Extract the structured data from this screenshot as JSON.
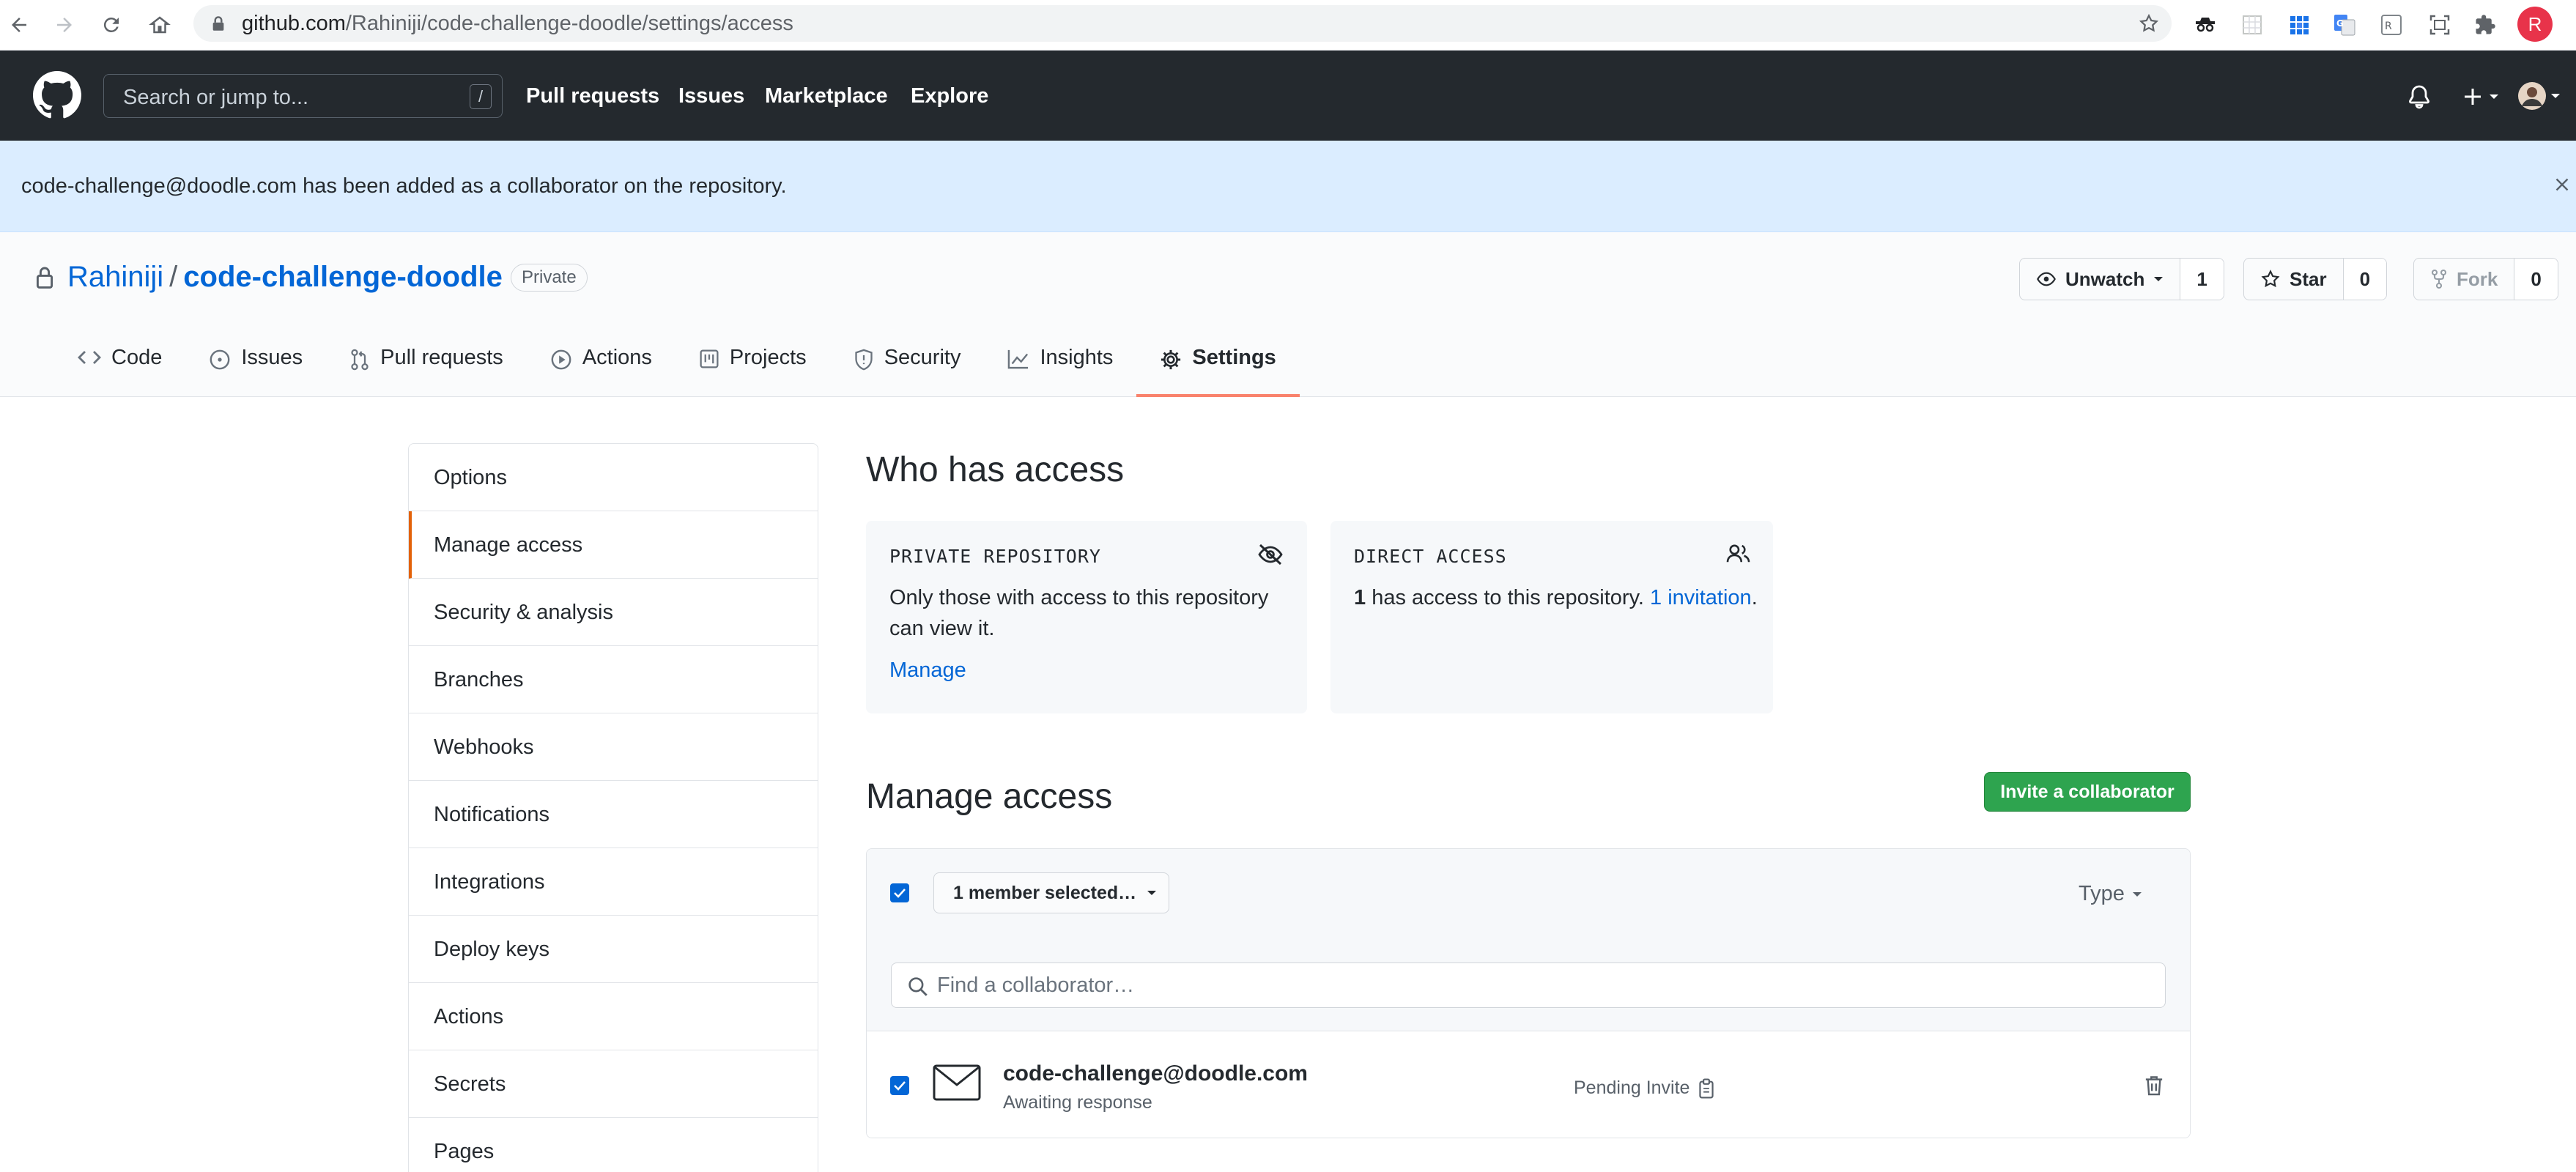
{
  "browser": {
    "url_host": "github.com",
    "url_path": "/Rahiniji/code-challenge-doodle/settings/access",
    "profile_initial": "R"
  },
  "header": {
    "search_placeholder": "Search or jump to...",
    "search_shortcut": "/",
    "nav": [
      "Pull requests",
      "Issues",
      "Marketplace",
      "Explore"
    ]
  },
  "flash": {
    "message": "code-challenge@doodle.com has been added as a collaborator on the repository."
  },
  "repo": {
    "owner": "Rahiniji",
    "separator": "/",
    "name": "code-challenge-doodle",
    "visibility": "Private",
    "watch_label": "Unwatch",
    "watch_count": "1",
    "star_label": "Star",
    "star_count": "0",
    "fork_label": "Fork",
    "fork_count": "0",
    "tabs": [
      "Code",
      "Issues",
      "Pull requests",
      "Actions",
      "Projects",
      "Security",
      "Insights",
      "Settings"
    ]
  },
  "sidebar": {
    "items": [
      "Options",
      "Manage access",
      "Security & analysis",
      "Branches",
      "Webhooks",
      "Notifications",
      "Integrations",
      "Deploy keys",
      "Actions",
      "Secrets",
      "Pages"
    ],
    "selected": "Manage access"
  },
  "who_has_access": {
    "title": "Who has access",
    "private_label": "PRIVATE REPOSITORY",
    "private_text": "Only those with access to this repository can view it.",
    "manage_link": "Manage",
    "direct_label": "DIRECT ACCESS",
    "direct_count": "1",
    "direct_text": " has access to this repository. ",
    "invitation_link": "1 invitation",
    "direct_suffix": "."
  },
  "manage_access": {
    "title": "Manage access",
    "invite_button": "Invite a collaborator",
    "member_selected": "1 member selected…",
    "type_filter": "Type",
    "find_placeholder": "Find a collaborator…",
    "collaborators": [
      {
        "email": "code-challenge@doodle.com",
        "status": "Awaiting response",
        "role": "Pending Invite"
      }
    ]
  },
  "colors": {
    "header_bg": "#24292e",
    "flash_bg": "#dbedff",
    "link": "#0366d6",
    "primary_button": "#2ea44f",
    "selected_tab_border": "#f9826c"
  }
}
